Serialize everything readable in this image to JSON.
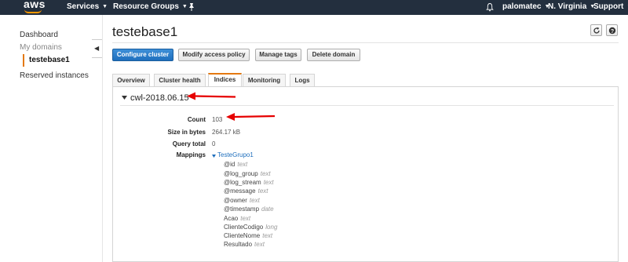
{
  "topnav": {
    "logo": "aws",
    "services": "Services",
    "resource_groups": "Resource Groups",
    "user": "palomatec",
    "region": "N. Virginia",
    "support": "Support"
  },
  "sidebar": {
    "dashboard": "Dashboard",
    "my_domains": "My domains",
    "active_domain": "testebase1",
    "reserved_instances": "Reserved instances"
  },
  "page": {
    "title": "testebase1"
  },
  "buttons": {
    "configure_cluster": "Configure cluster",
    "modify_access_policy": "Modify access policy",
    "manage_tags": "Manage tags",
    "delete_domain": "Delete domain"
  },
  "tabs": [
    "Overview",
    "Cluster health",
    "Indices",
    "Monitoring",
    "Logs"
  ],
  "index": {
    "name": "cwl-2018.06.15",
    "count_label": "Count",
    "count": "103",
    "size_label": "Size in bytes",
    "size": "264.17 kB",
    "query_label": "Query total",
    "query_total": "0",
    "mappings_label": "Mappings",
    "mapping_name": "TesteGrupo1",
    "fields": [
      {
        "name": "@id",
        "type": "text"
      },
      {
        "name": "@log_group",
        "type": "text"
      },
      {
        "name": "@log_stream",
        "type": "text"
      },
      {
        "name": "@message",
        "type": "text"
      },
      {
        "name": "@owner",
        "type": "text"
      },
      {
        "name": "@timestamp",
        "type": "date"
      },
      {
        "name": "Acao",
        "type": "text"
      },
      {
        "name": "ClienteCodigo",
        "type": "long"
      },
      {
        "name": "ClienteNome",
        "type": "text"
      },
      {
        "name": "Resultado",
        "type": "text"
      }
    ]
  },
  "colors": {
    "nav_bg": "#232f3e",
    "accent_orange": "#e47911",
    "primary_blue": "#1f6fbd",
    "annotation_red": "#e60000"
  }
}
